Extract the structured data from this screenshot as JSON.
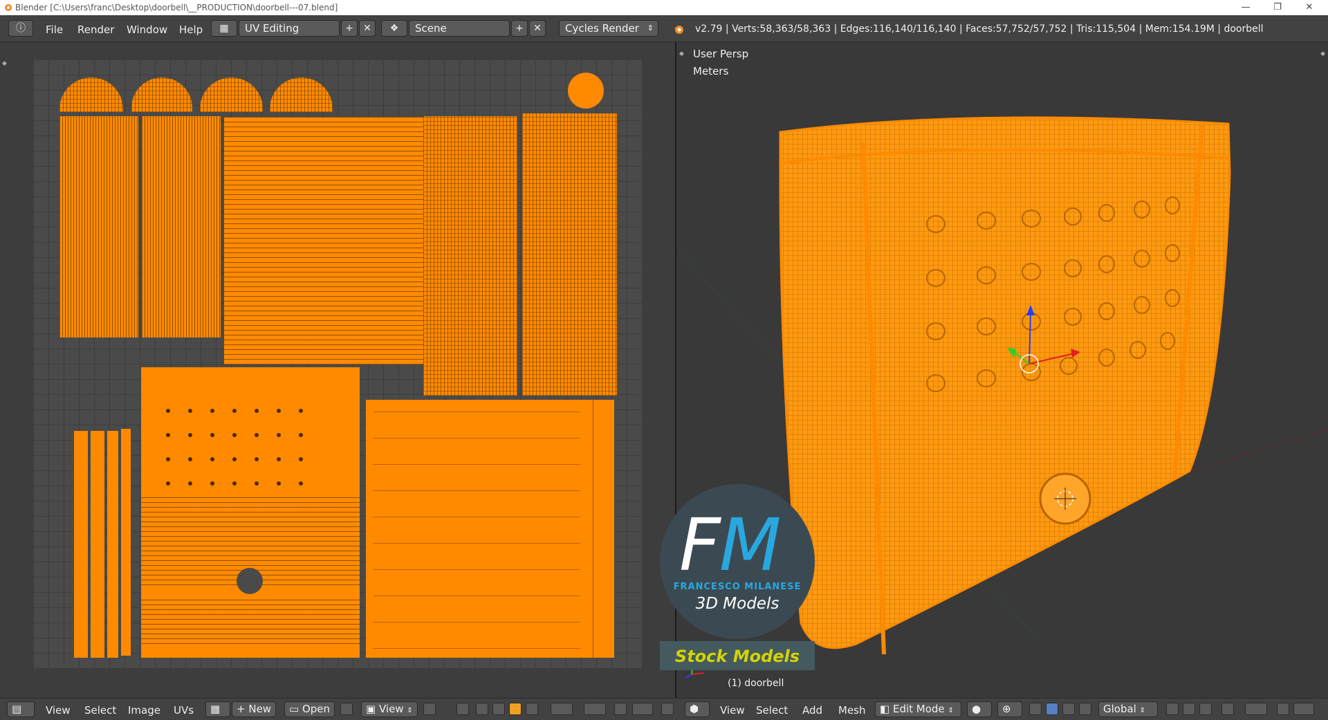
{
  "window": {
    "title": "Blender [C:\\Users\\franc\\Desktop\\doorbell\\__PRODUCTION\\doorbell---07.blend]",
    "controls": [
      "—",
      "❐",
      "✕"
    ]
  },
  "menu": [
    "File",
    "Render",
    "Window",
    "Help"
  ],
  "screen_layout": "UV Editing",
  "scene": "Scene",
  "render_engine": "Cycles Render",
  "stats": "v2.79 | Verts:58,363/58,363 | Edges:116,140/116,140 | Faces:57,752/57,752 | Tris:115,504 | Mem:154.19M | doorbell",
  "viewport": {
    "view_name": "User Persp",
    "units": "Meters",
    "object_label": "(1) doorbell"
  },
  "watermark": {
    "letters": "FM",
    "name": "FRANCESCO MILANESE",
    "tagline": "3D Models",
    "banner": "Stock Models"
  },
  "uv_bottom": {
    "menus": [
      "View",
      "Select",
      "Image",
      "UVs"
    ],
    "new_label": "New",
    "open_label": "Open",
    "view_label": "View"
  },
  "view3d_bottom": {
    "menus": [
      "View",
      "Select",
      "Add",
      "Mesh"
    ],
    "mode": "Edit Mode",
    "orientation": "Global"
  },
  "colors": {
    "mesh_orange": "#ff8a00",
    "panel_bg": "#3d3d3d",
    "header_bg": "#424242",
    "logo_blue": "#29a8e0",
    "logo_yellow": "#d4d400"
  }
}
